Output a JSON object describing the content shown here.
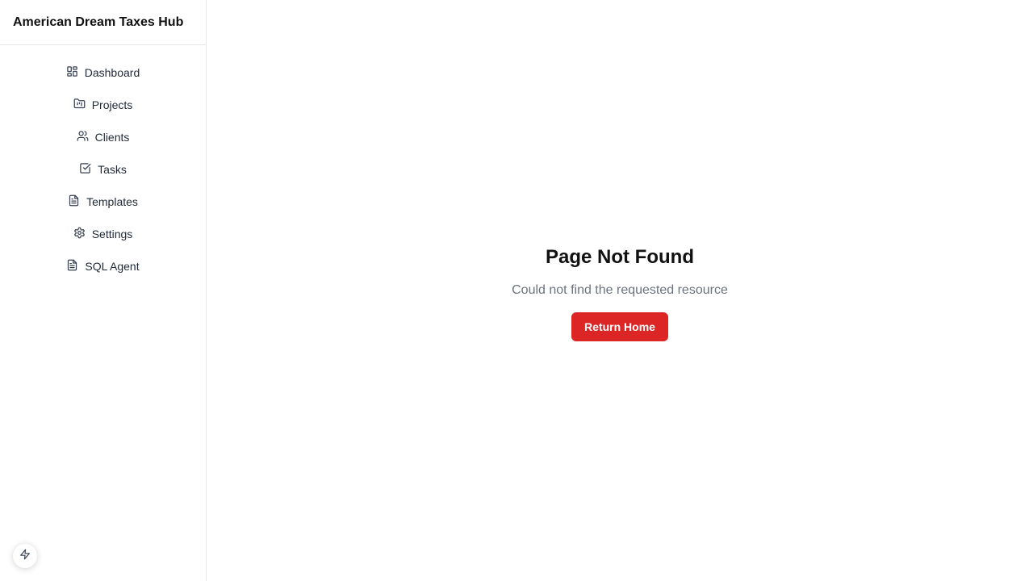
{
  "app": {
    "title": "American Dream Taxes Hub"
  },
  "sidebar": {
    "items": [
      {
        "label": "Dashboard",
        "icon": "dashboard-icon"
      },
      {
        "label": "Projects",
        "icon": "folder-kanban-icon"
      },
      {
        "label": "Clients",
        "icon": "users-icon"
      },
      {
        "label": "Tasks",
        "icon": "check-square-icon"
      },
      {
        "label": "Templates",
        "icon": "file-text-icon"
      },
      {
        "label": "Settings",
        "icon": "gear-icon"
      },
      {
        "label": "SQL Agent",
        "icon": "file-text-icon"
      }
    ],
    "fab_icon": "lightning-icon"
  },
  "main": {
    "title": "Page Not Found",
    "description": "Could not find the requested resource",
    "button_label": "Return Home"
  },
  "colors": {
    "accent": "#dc2626",
    "text_muted": "#6b7280",
    "border": "#e5e7eb"
  }
}
